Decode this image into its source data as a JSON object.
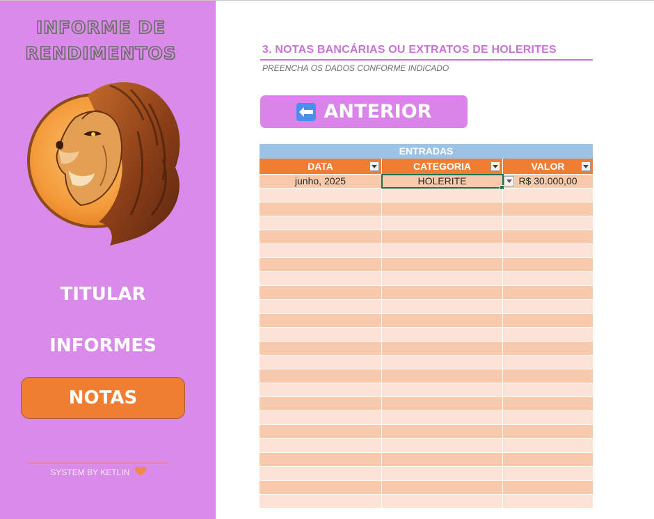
{
  "sidebar": {
    "title_line1": "INFORME DE",
    "title_line2": "RENDIMENTOS",
    "logo_icon": "lion-icon",
    "nav": {
      "titular": "TITULAR",
      "informes": "INFORMES",
      "notas": "NOTAS"
    },
    "footer": "SYSTEM BY KETLIN",
    "footer_icon": "heart-icon"
  },
  "main": {
    "section_title": "3. NOTAS BANCÁRIAS OU EXTRATOS DE HOLERITES",
    "section_subtitle": "PREENCHA OS DADOS CONFORME INDICADO",
    "back_button": "ANTERIOR",
    "back_icon": "left-arrow-icon",
    "table": {
      "group_header": "ENTRADAS",
      "columns": [
        "DATA",
        "CATEGORIA",
        "VALOR"
      ],
      "rows": [
        [
          "junho, 2025",
          "HOLERITE",
          "R$ 30.000,00"
        ]
      ],
      "selected_cell": "CATEGORIA"
    }
  },
  "colors": {
    "sidebar": "#da8ae9",
    "accent_orange": "#ef7e32",
    "header_blue": "#9cc2e5",
    "row_dark": "#f7caac",
    "row_light": "#fbe4d5",
    "title_purple": "#c773d4"
  }
}
